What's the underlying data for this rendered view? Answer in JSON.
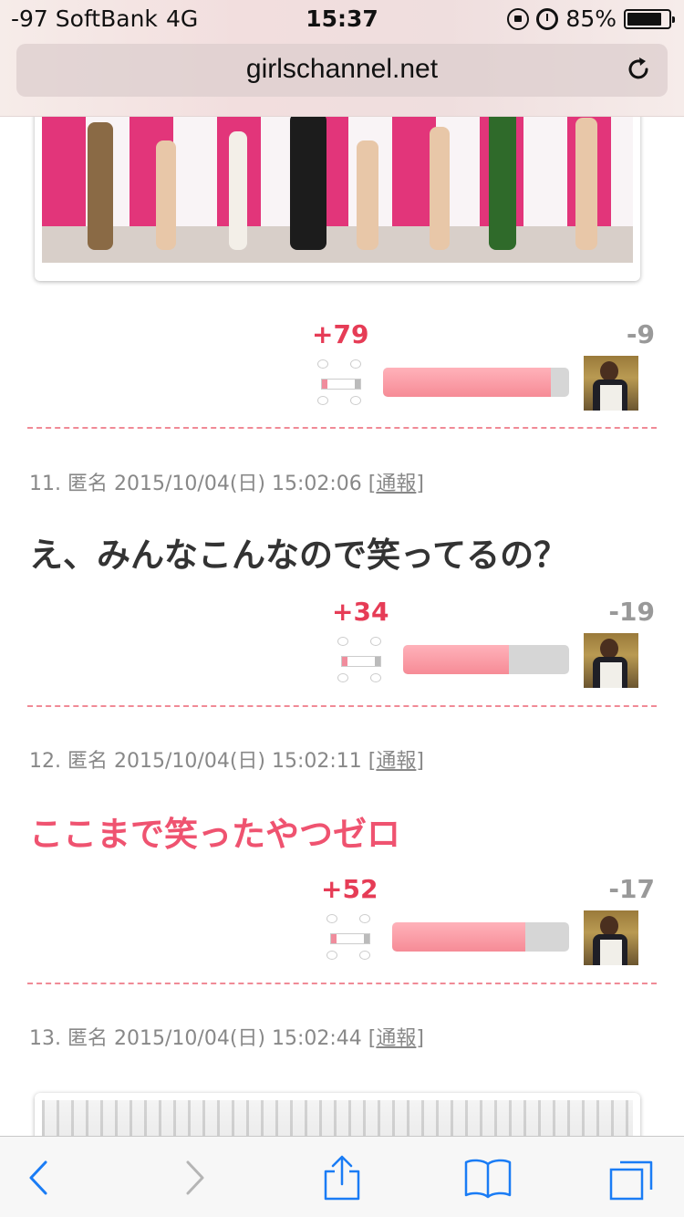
{
  "status_bar": {
    "carrier": "-97 SoftBank",
    "network": "4G",
    "time": "15:37",
    "battery_percent": "85%",
    "battery_level": 0.85,
    "icons": [
      "orientation-lock-icon",
      "alarm-icon",
      "battery-icon"
    ]
  },
  "address_bar": {
    "url": "girlschannel.net",
    "reload_icon": "reload-icon"
  },
  "comments": [
    {
      "votes": {
        "plus": "+79",
        "minus": "-9",
        "ratio": 0.9
      }
    },
    {
      "meta": {
        "number": "11.",
        "author": "匿名",
        "datetime": "2015/10/04(日) 15:02:06",
        "report_open": "[",
        "report": "通報",
        "report_close": "]"
      },
      "text": "え、みんなこんなので笑ってるの？",
      "votes": {
        "plus": "+34",
        "minus": "-19",
        "ratio": 0.64
      }
    },
    {
      "meta": {
        "number": "12.",
        "author": "匿名",
        "datetime": "2015/10/04(日) 15:02:11",
        "report_open": "[",
        "report": "通報",
        "report_close": "]"
      },
      "text": "ここまで笑ったやつゼロ",
      "text_color": "#ef5370",
      "votes": {
        "plus": "+52",
        "minus": "-17",
        "ratio": 0.75
      }
    },
    {
      "meta": {
        "number": "13.",
        "author": "匿名",
        "datetime": "2015/10/04(日) 15:02:44",
        "report_open": "[",
        "report": "通報",
        "report_close": "]"
      }
    }
  ],
  "toolbar": {
    "buttons": [
      "back-icon",
      "forward-icon",
      "share-icon",
      "bookmarks-icon",
      "tabs-icon"
    ]
  },
  "colors": {
    "accent_pink": "#ef5370",
    "plus_red": "#e63c56",
    "minus_gray": "#999999",
    "ios_blue": "#1a7cf5"
  }
}
